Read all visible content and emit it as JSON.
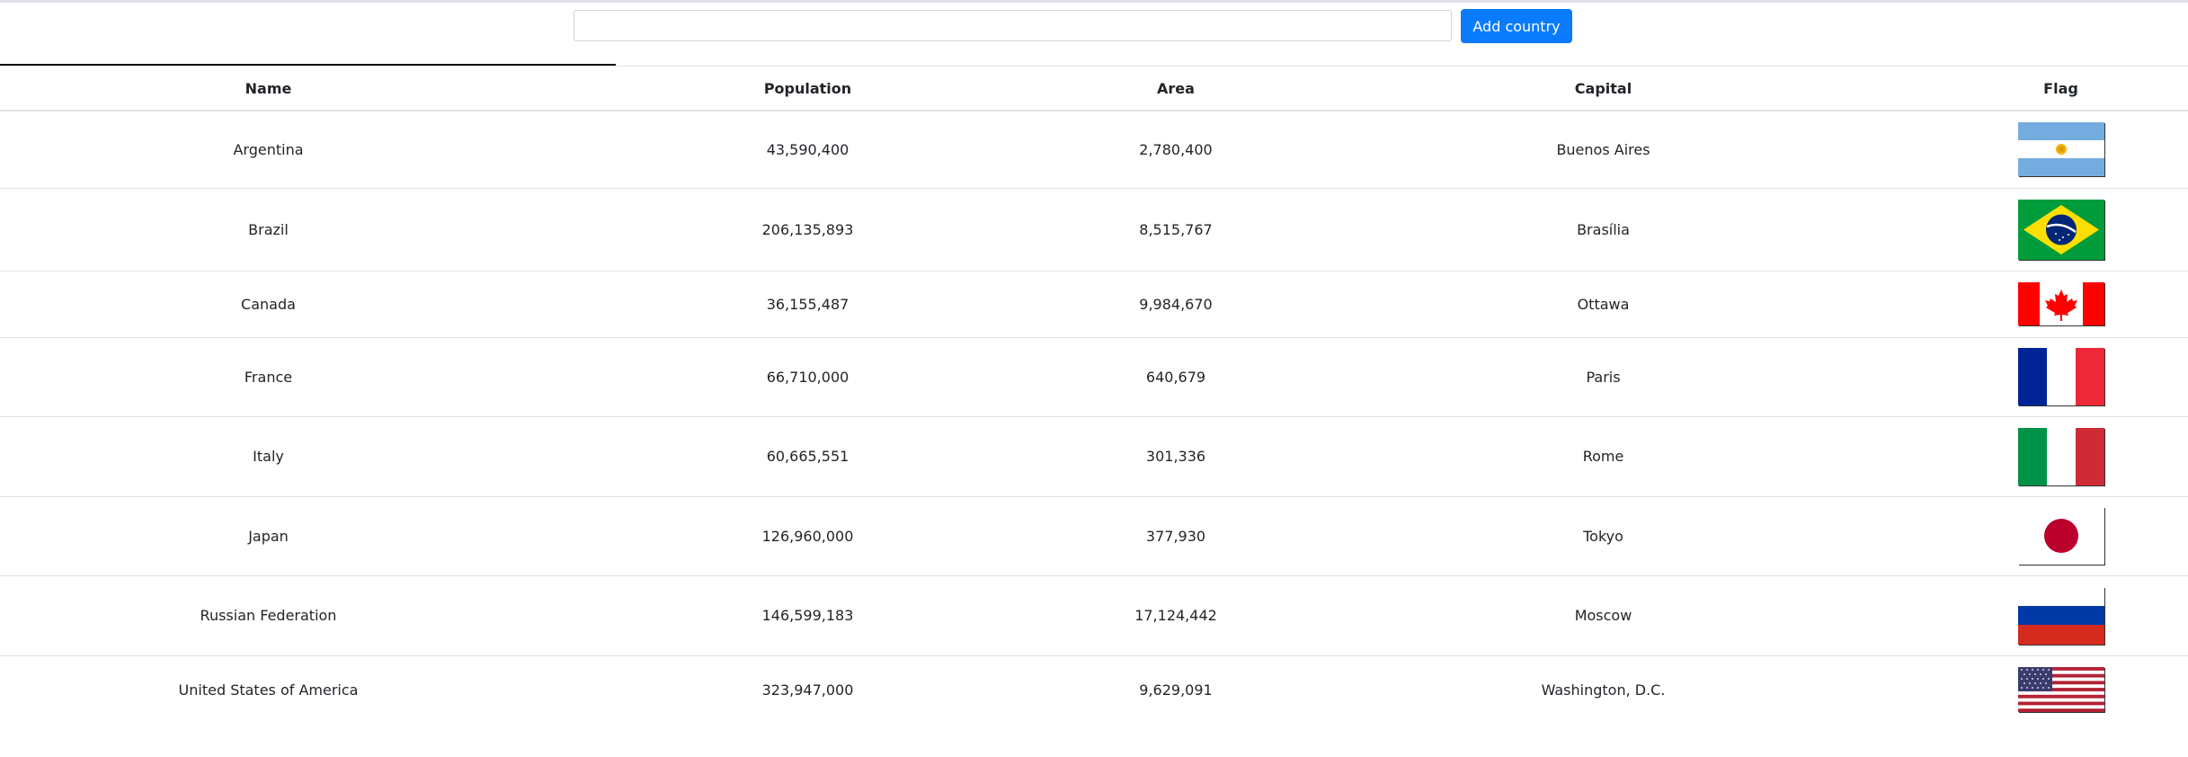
{
  "toolbar": {
    "search_value": "",
    "search_placeholder": "",
    "add_button_label": "Add country",
    "accent_color": "#0a7bfd"
  },
  "table": {
    "headers": {
      "name": "Name",
      "population": "Population",
      "area": "Area",
      "capital": "Capital",
      "flag": "Flag"
    },
    "rows": [
      {
        "name": "Argentina",
        "population": "43,590,400",
        "area": "2,780,400",
        "capital": "Buenos Aires",
        "flag": "argentina-flag-icon"
      },
      {
        "name": "Brazil",
        "population": "206,135,893",
        "area": "8,515,767",
        "capital": "Brasília",
        "flag": "brazil-flag-icon"
      },
      {
        "name": "Canada",
        "population": "36,155,487",
        "area": "9,984,670",
        "capital": "Ottawa",
        "flag": "canada-flag-icon"
      },
      {
        "name": "France",
        "population": "66,710,000",
        "area": "640,679",
        "capital": "Paris",
        "flag": "france-flag-icon"
      },
      {
        "name": "Italy",
        "population": "60,665,551",
        "area": "301,336",
        "capital": "Rome",
        "flag": "italy-flag-icon"
      },
      {
        "name": "Japan",
        "population": "126,960,000",
        "area": "377,930",
        "capital": "Tokyo",
        "flag": "japan-flag-icon"
      },
      {
        "name": "Russian Federation",
        "population": "146,599,183",
        "area": "17,124,442",
        "capital": "Moscow",
        "flag": "russia-flag-icon"
      },
      {
        "name": "United States of America",
        "population": "323,947,000",
        "area": "9,629,091",
        "capital": "Washington, D.C.",
        "flag": "usa-flag-icon"
      }
    ]
  }
}
